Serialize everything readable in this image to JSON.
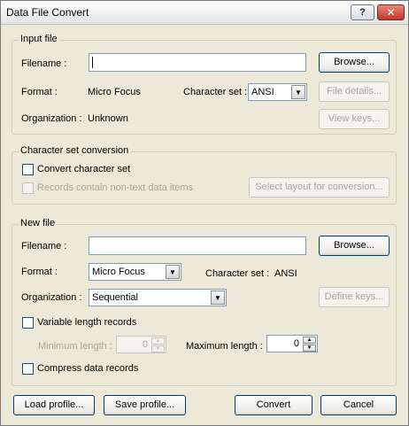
{
  "window": {
    "title": "Data File Convert",
    "help_glyph": "?",
    "close_glyph": "✕"
  },
  "input_file": {
    "group_label": "Input file",
    "filename_label": "Filename :",
    "filename_value": "",
    "browse_label": "Browse...",
    "format_label": "Format :",
    "format_value": "Micro Focus",
    "charset_label": "Character set :",
    "charset_value": "ANSI",
    "file_details_label": "File details...",
    "organization_label": "Organization :",
    "organization_value": "Unknown",
    "view_keys_label": "View keys..."
  },
  "charset_conversion": {
    "group_label": "Character set conversion",
    "convert_label": "Convert character set",
    "non_text_label": "Records contain non-text data items",
    "select_layout_label": "Select layout for conversion..."
  },
  "new_file": {
    "group_label": "New file",
    "filename_label": "Filename :",
    "filename_value": "",
    "browse_label": "Browse...",
    "format_label": "Format :",
    "format_value": "Micro Focus",
    "charset_label": "Character set :",
    "charset_value": "ANSI",
    "organization_label": "Organization :",
    "organization_value": "Sequential",
    "define_keys_label": "Define keys...",
    "variable_length_label": "Variable length records",
    "min_length_label": "Minimum length :",
    "min_length_value": "0",
    "max_length_label": "Maximum length :",
    "max_length_value": "0",
    "compress_label": "Compress data records"
  },
  "footer": {
    "load_profile_label": "Load profile...",
    "save_profile_label": "Save profile...",
    "convert_label": "Convert",
    "cancel_label": "Cancel"
  },
  "icons": {
    "dropdown": "▼",
    "spin_up": "▲",
    "spin_down": "▼"
  }
}
